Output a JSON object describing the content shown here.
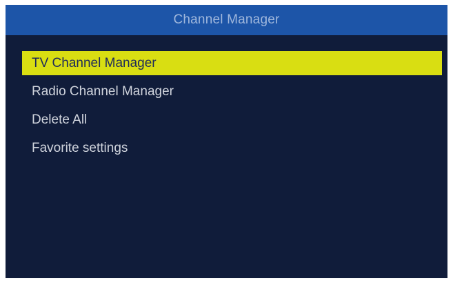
{
  "header": {
    "title": "Channel Manager"
  },
  "menu": {
    "selected_index": 0,
    "items": [
      {
        "label": "TV Channel Manager"
      },
      {
        "label": "Radio Channel Manager"
      },
      {
        "label": "Delete All"
      },
      {
        "label": "Favorite settings"
      }
    ]
  },
  "colors": {
    "title_bar": "#1d55a8",
    "background": "#101c3a",
    "highlight": "#d9de12",
    "text": "#cfd3dc"
  }
}
